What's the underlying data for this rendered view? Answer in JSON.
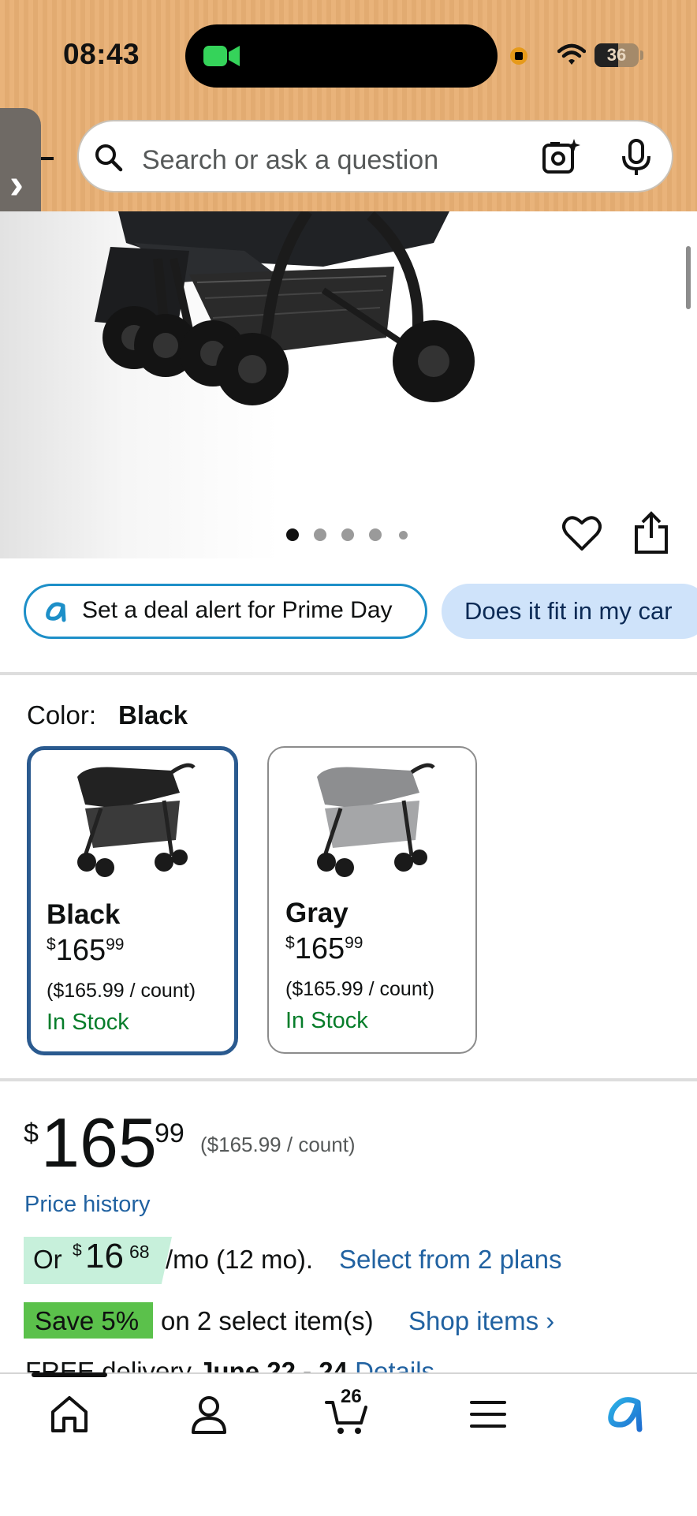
{
  "status_bar": {
    "time": "08:43",
    "battery": "36"
  },
  "search": {
    "placeholder": "Search or ask a question"
  },
  "gallery": {
    "image_count": 5,
    "active_index": 0
  },
  "chips": {
    "deal_alert": "Set a deal alert for Prime Day",
    "fit_question": "Does it fit in my car"
  },
  "color": {
    "label": "Color:",
    "selected": "Black",
    "options": [
      {
        "name": "Black",
        "price_symbol": "$",
        "price_whole": "165",
        "price_fraction": "99",
        "unit_price": "($165.99 / count)",
        "stock": "In Stock"
      },
      {
        "name": "Gray",
        "price_symbol": "$",
        "price_whole": "165",
        "price_fraction": "99",
        "unit_price": "($165.99 / count)",
        "stock": "In Stock"
      }
    ]
  },
  "price": {
    "symbol": "$",
    "whole": "165",
    "fraction": "99",
    "unit_price": "($165.99 / count)",
    "history_link": "Price history"
  },
  "installments": {
    "prefix": "Or",
    "symbol": "$",
    "whole": "16",
    "fraction": "68",
    "suffix": "/mo (12 mo).",
    "link": "Select from 2 plans"
  },
  "promo": {
    "badge": "Save 5%",
    "text": "on 2 select item(s)",
    "link": "Shop items ›"
  },
  "delivery": {
    "prefix": "FREE delivery",
    "dates": "June 22 - 24",
    "link": "Details"
  },
  "bottom_nav": {
    "cart_count": "26"
  },
  "colors": {
    "header_bg": "#e9b37a",
    "link": "#2162a1",
    "in_stock": "#067d2a",
    "selected_border": "#2a5a8f",
    "save_badge": "#5bc14b",
    "installment_bg": "#c7f0db",
    "fit_chip_bg": "#cfe3fa"
  }
}
